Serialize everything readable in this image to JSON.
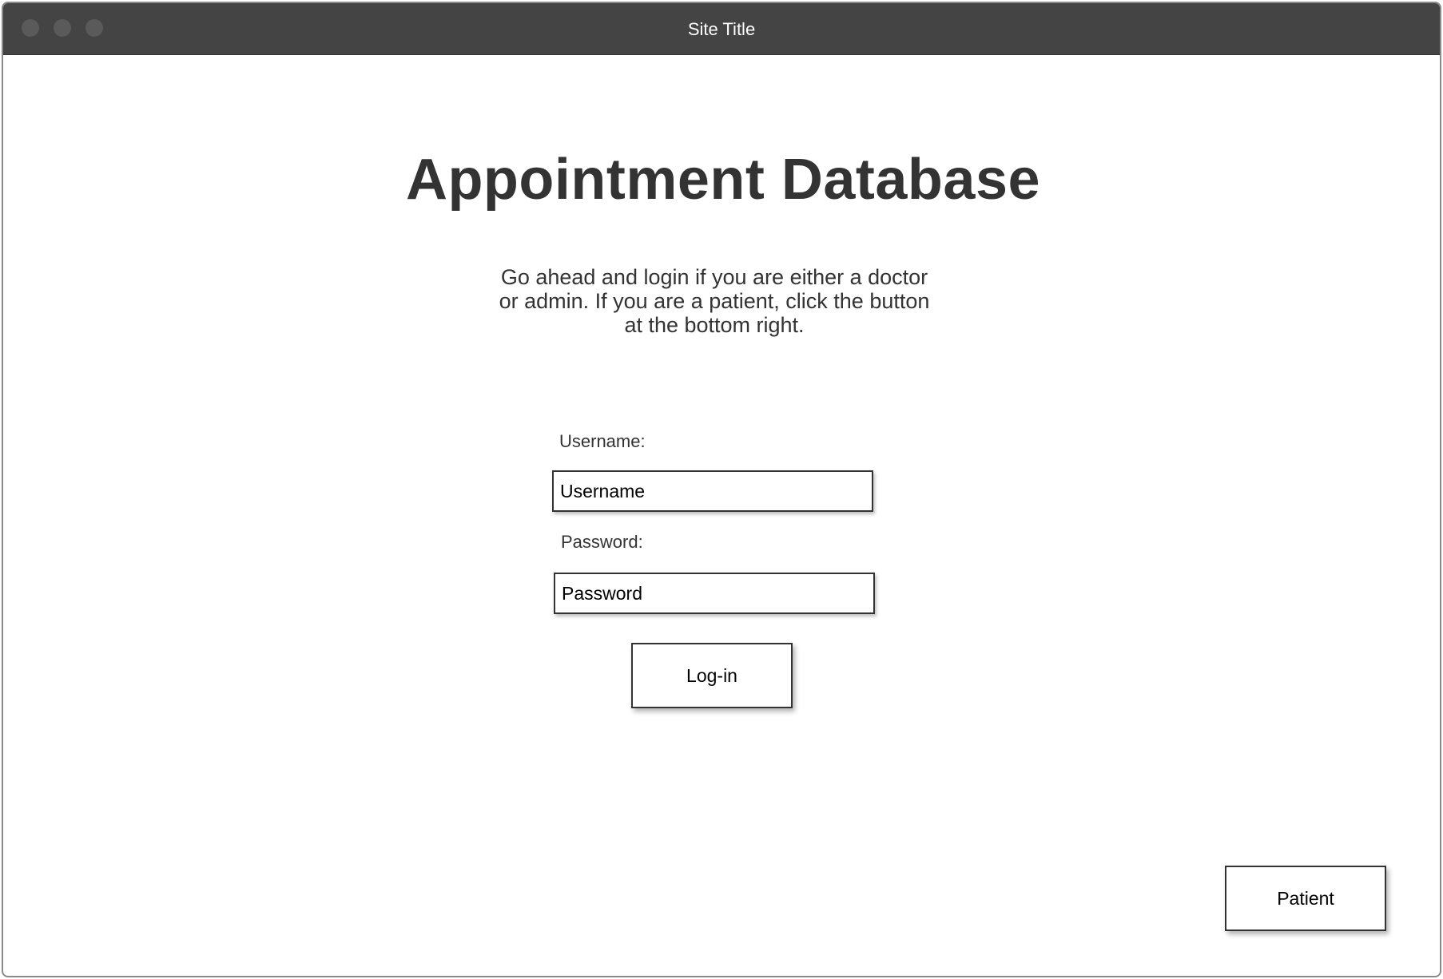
{
  "window": {
    "title": "Site Title"
  },
  "main": {
    "heading": "Appointment Database",
    "intro": "Go ahead and login if you are either a doctor or admin. If you are a patient, click the button at the bottom right."
  },
  "form": {
    "username_label": "Username:",
    "username_placeholder": "Username",
    "password_label": "Password:",
    "password_placeholder": "Password",
    "login_label": "Log-in"
  },
  "patient_button": {
    "label": "Patient"
  }
}
